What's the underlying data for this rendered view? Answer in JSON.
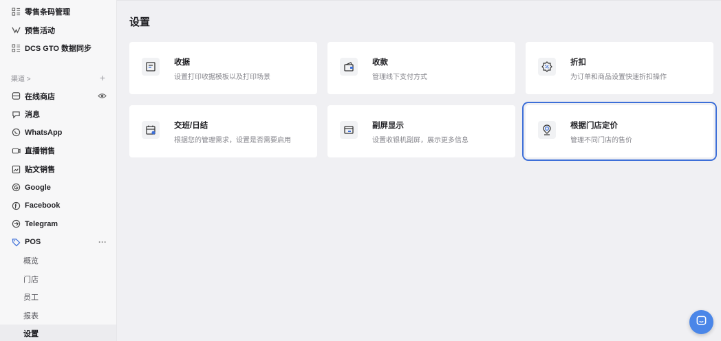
{
  "sidebar": {
    "top_items": [
      {
        "label": "零售条码管理",
        "icon": "grid-icon"
      },
      {
        "label": "预售活动",
        "icon": "tag-fork-icon"
      },
      {
        "label": "DCS GTO 数据同步",
        "icon": "grid-icon"
      }
    ],
    "section": {
      "label": "渠道 >",
      "plus": "+"
    },
    "channels": [
      {
        "label": "在线商店",
        "icon": "store-icon",
        "trail": "eye-icon"
      },
      {
        "label": "消息",
        "icon": "message-icon"
      },
      {
        "label": "WhatsApp",
        "icon": "whatsapp-icon"
      },
      {
        "label": "直播销售",
        "icon": "live-icon"
      },
      {
        "label": "贴文销售",
        "icon": "post-icon"
      },
      {
        "label": "Google",
        "icon": "google-icon"
      },
      {
        "label": "Facebook",
        "icon": "facebook-icon"
      },
      {
        "label": "Telegram",
        "icon": "telegram-icon"
      },
      {
        "label": "POS",
        "icon": "pos-tag-icon",
        "trail": "···"
      }
    ],
    "pos_sub": [
      {
        "label": "概览"
      },
      {
        "label": "门店"
      },
      {
        "label": "员工"
      },
      {
        "label": "报表"
      },
      {
        "label": "设置",
        "active": true
      }
    ]
  },
  "main": {
    "title": "设置",
    "cards": [
      {
        "title": "收据",
        "desc": "设置打印收据模板以及打印场景",
        "icon": "receipt-icon"
      },
      {
        "title": "收款",
        "desc": "管理线下支付方式",
        "icon": "wallet-icon"
      },
      {
        "title": "折扣",
        "desc": "为订单和商品设置快速折扣操作",
        "icon": "discount-icon"
      },
      {
        "title": "交班/日结",
        "desc": "根据您的管理需求，设置是否需要启用",
        "icon": "shift-calendar-icon"
      },
      {
        "title": "副屏显示",
        "desc": "设置收银机副屏，展示更多信息",
        "icon": "screen-icon"
      },
      {
        "title": "根据门店定价",
        "desc": "管理不同门店的售价",
        "icon": "store-pricing-icon",
        "selected": true
      }
    ]
  },
  "colors": {
    "accent": "#3d6fd8",
    "fab": "#4a86e8",
    "pos_icon": "#3d6fd8"
  }
}
